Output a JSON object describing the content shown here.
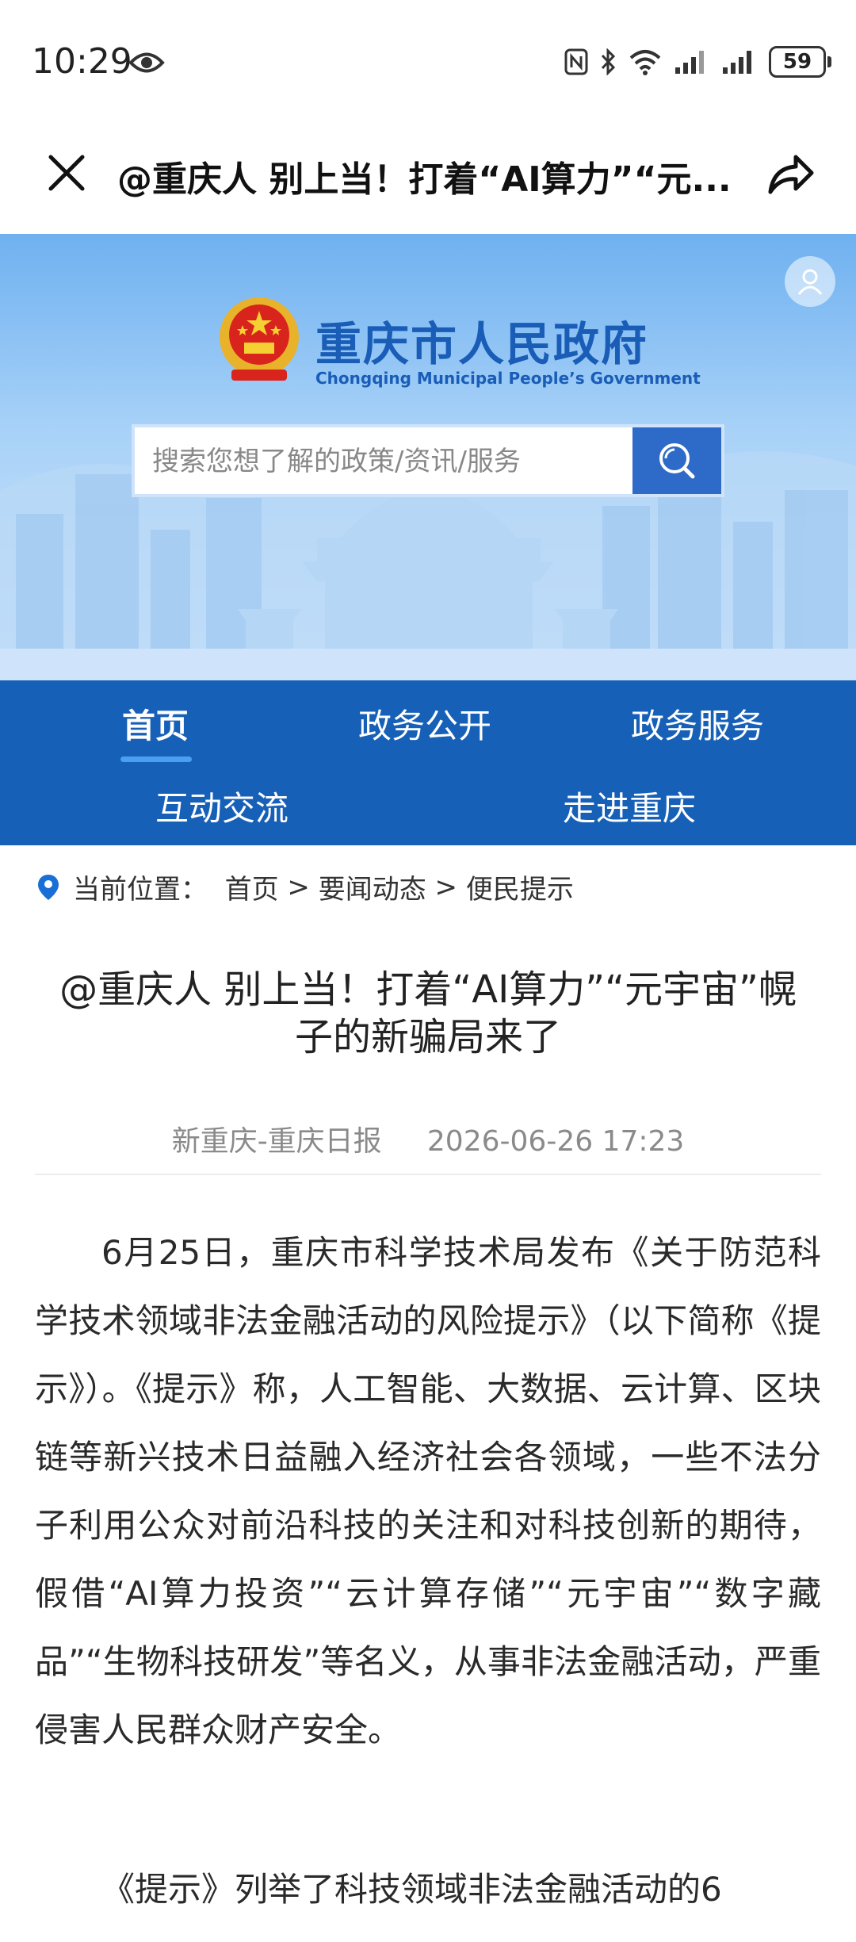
{
  "status_bar": {
    "time": "10:29",
    "battery": "59"
  },
  "title_bar": {
    "title": "@重庆人 别上当！打着“AI算力”“元..."
  },
  "site": {
    "name": "重庆市人民政府",
    "name_en": "Chongqing Municipal People’s Government",
    "search_placeholder": "搜索您想了解的政策/资讯/服务"
  },
  "nav": {
    "items": [
      {
        "label": "首页"
      },
      {
        "label": "政务公开"
      },
      {
        "label": "政务服务"
      },
      {
        "label": "互动交流"
      },
      {
        "label": "走进重庆"
      }
    ]
  },
  "breadcrumb": {
    "label": "当前位置：",
    "path": [
      "首页",
      "要闻动态",
      "便民提示"
    ],
    "sep": " > "
  },
  "article": {
    "headline": "@重庆人 别上当！打着“AI算力”“元宇宙”幌子的新骗局来了",
    "source": "新重庆-重庆日报",
    "datetime": "2026-06-26 17:23",
    "paragraph1": "6月25日，重庆市科学技术局发布《关于防范科学技术领域非法金融活动的风险提示》（以下简称《提示》）。《提示》称，人工智能、大数据、云计算、区块链等新兴技术日益融入经济社会各领域，一些不法分子利用公众对前沿科技的关注和对科技创新的期待，假借“AI算力投资”“云计算存储”“元宇宙”“数字藏品”“生物科技研发”等名义，从事非法金融活动，严重侵害人民群众财产安全。",
    "paragraph2": "《提示》列举了科技领域非法金融活动的6"
  },
  "colors": {
    "nav_bg": "#1760b7",
    "brand": "#1a5db7",
    "search_btn": "#2e6ac8"
  }
}
